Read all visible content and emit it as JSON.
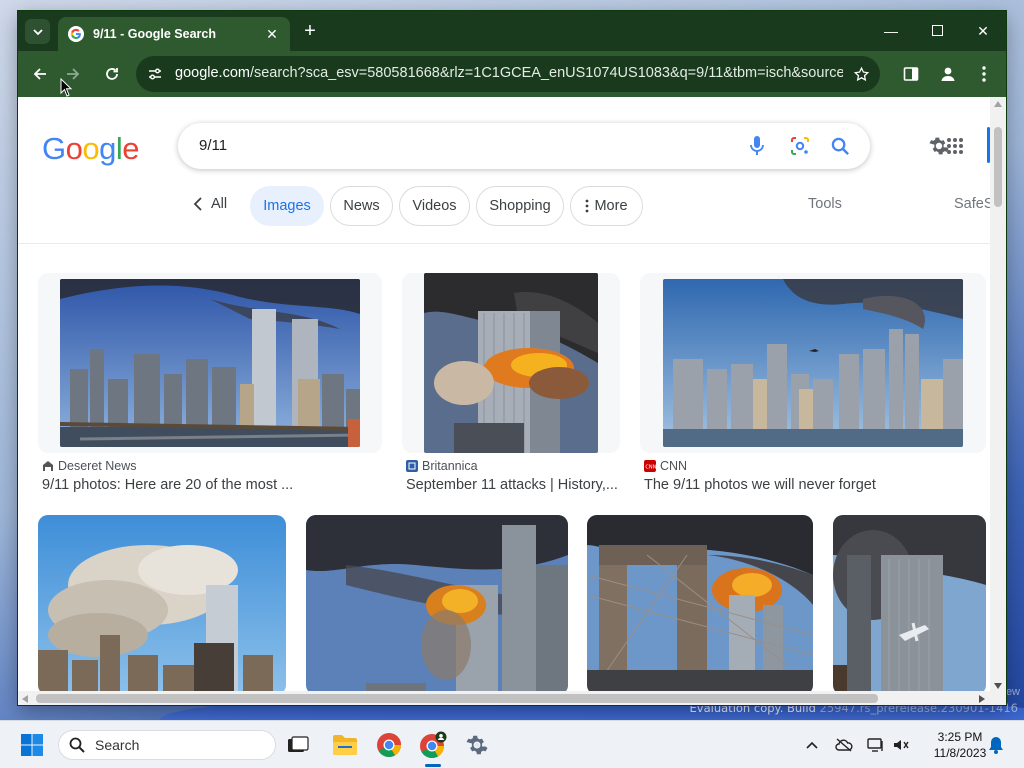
{
  "browser": {
    "tab_title": "9/11 - Google Search",
    "url_domain": "google.com",
    "url_rest": "/search?sca_esv=580581668&rlz=1C1GCEA_enUS1074US1083&q=9/11&tbm=isch&source=In..."
  },
  "google": {
    "query": "9/11",
    "logo": "Google",
    "chips": {
      "all": "All",
      "images": "Images",
      "news": "News",
      "videos": "Videos",
      "shopping": "Shopping",
      "more": "More",
      "tools": "Tools",
      "safesearch": "SafeS"
    },
    "results": [
      {
        "source": "Deseret News",
        "caption": "9/11 photos: Here are 20 of the most ..."
      },
      {
        "source": "Britannica",
        "caption": "September 11 attacks | History,..."
      },
      {
        "source": "CNN",
        "caption": "The 9/11 photos we will never forget"
      }
    ]
  },
  "taskbar": {
    "search_label": "Search",
    "time": "3:25 PM",
    "date": "11/8/2023"
  },
  "desktop": {
    "eval_text": "Evaluation copy. Build",
    "eval_build": "25947.rs_prerelease.230901-1416",
    "corner": "ew"
  },
  "colors": {
    "chrome_frame": "#1a3a1d",
    "chrome_toolbar": "#2f5a30",
    "accent_blue": "#1a73e8"
  }
}
